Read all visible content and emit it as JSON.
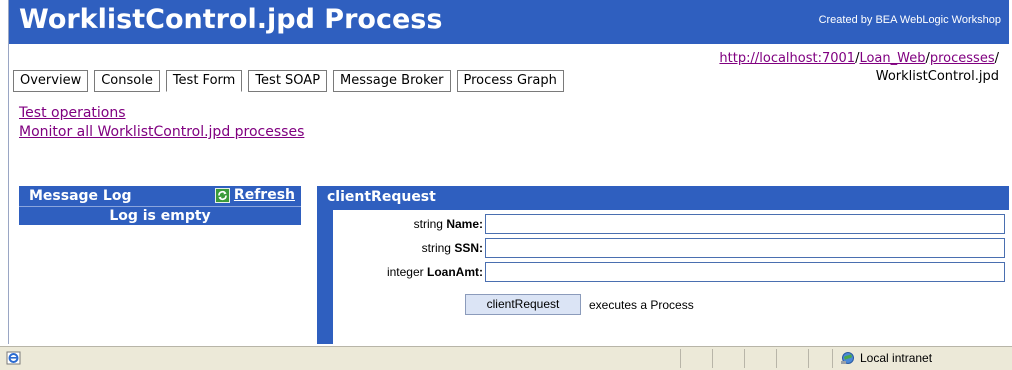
{
  "header": {
    "title": "WorklistControl.jpd Process",
    "created_by": "Created by BEA WebLogic Workshop"
  },
  "url_path": {
    "host": "http://localhost:7001",
    "sep1": "/",
    "app": "Loan_Web",
    "sep2": "/",
    "folder": "processes",
    "sep3": "/",
    "file": "WorklistControl.jpd"
  },
  "tabs": [
    {
      "label": "Overview"
    },
    {
      "label": "Console"
    },
    {
      "label": "Test Form",
      "active": true
    },
    {
      "label": "Test SOAP"
    },
    {
      "label": "Message Broker"
    },
    {
      "label": "Process Graph"
    }
  ],
  "links": {
    "test_operations": "Test operations",
    "monitor_all": "Monitor all WorklistControl.jpd processes"
  },
  "message_log": {
    "title": "Message Log",
    "refresh_label": "Refresh",
    "empty_text": "Log is empty"
  },
  "client_request": {
    "title": "clientRequest",
    "fields": [
      {
        "type": "string",
        "name": "Name:",
        "value": ""
      },
      {
        "type": "string",
        "name": "SSN:",
        "value": ""
      },
      {
        "type": "integer",
        "name": "LoanAmt:",
        "value": ""
      }
    ],
    "button_label": "clientRequest",
    "executes_text": "executes a Process"
  },
  "statusbar": {
    "zone": "Local intranet"
  },
  "colors": {
    "brand_blue": "#2f5fbf",
    "link_visited": "#800080"
  }
}
